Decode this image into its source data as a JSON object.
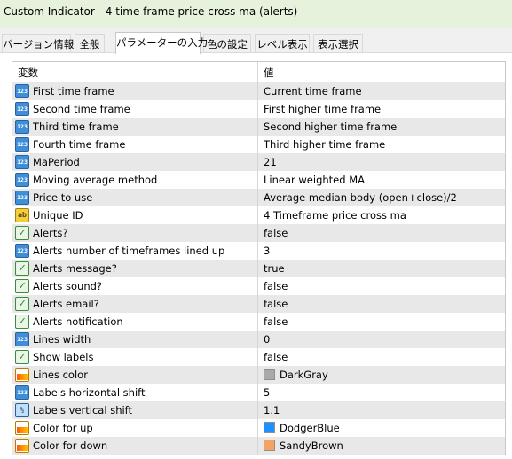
{
  "window": {
    "title": "Custom Indicator - 4 time frame price cross ma (alerts)"
  },
  "tabs": [
    {
      "label": "バージョン情報",
      "active": false
    },
    {
      "label": "全般",
      "active": false
    },
    {
      "label": "パラメーターの入力",
      "active": true
    },
    {
      "label": "色の設定",
      "active": false
    },
    {
      "label": "レベル表示",
      "active": false
    },
    {
      "label": "表示選択",
      "active": false
    }
  ],
  "grid": {
    "headers": {
      "variable": "変数",
      "value": "値"
    },
    "rows": [
      {
        "type": "int",
        "icon": "123",
        "name": "First time frame",
        "value": "Current time frame"
      },
      {
        "type": "int",
        "icon": "123",
        "name": "Second time frame",
        "value": "First higher time frame"
      },
      {
        "type": "int",
        "icon": "123",
        "name": "Third time frame",
        "value": "Second higher time frame"
      },
      {
        "type": "int",
        "icon": "123",
        "name": "Fourth time frame",
        "value": "Third higher time frame"
      },
      {
        "type": "int",
        "icon": "123",
        "name": "MaPeriod",
        "value": "21"
      },
      {
        "type": "int",
        "icon": "123",
        "name": "Moving average method",
        "value": "Linear weighted MA"
      },
      {
        "type": "int",
        "icon": "123",
        "name": "Price to use",
        "value": "Average median body (open+close)/2"
      },
      {
        "type": "string",
        "icon": "ab",
        "name": "Unique ID",
        "value": "4 Timeframe price cross ma"
      },
      {
        "type": "bool",
        "icon": "✓",
        "name": "Alerts?",
        "value": "false"
      },
      {
        "type": "int",
        "icon": "123",
        "name": "Alerts number of timeframes lined up",
        "value": "3"
      },
      {
        "type": "bool",
        "icon": "✓",
        "name": "Alerts message?",
        "value": "true"
      },
      {
        "type": "bool",
        "icon": "✓",
        "name": "Alerts sound?",
        "value": "false"
      },
      {
        "type": "bool",
        "icon": "✓",
        "name": "Alerts email?",
        "value": "false"
      },
      {
        "type": "bool",
        "icon": "✓",
        "name": "Alerts notification",
        "value": "false"
      },
      {
        "type": "int",
        "icon": "123",
        "name": "Lines width",
        "value": "0"
      },
      {
        "type": "bool",
        "icon": "✓",
        "name": "Show labels",
        "value": "false"
      },
      {
        "type": "color",
        "icon": "",
        "name": "Lines color",
        "value": "DarkGray",
        "swatch": "#a9a9a9"
      },
      {
        "type": "int",
        "icon": "123",
        "name": "Labels horizontal shift",
        "value": "5"
      },
      {
        "type": "double",
        "icon": "½",
        "name": "Labels vertical shift",
        "value": "1.1"
      },
      {
        "type": "color",
        "icon": "",
        "name": "Color for up",
        "value": "DodgerBlue",
        "swatch": "#1e90ff"
      },
      {
        "type": "color",
        "icon": "",
        "name": "Color for down",
        "value": "SandyBrown",
        "swatch": "#f4a460"
      }
    ]
  }
}
